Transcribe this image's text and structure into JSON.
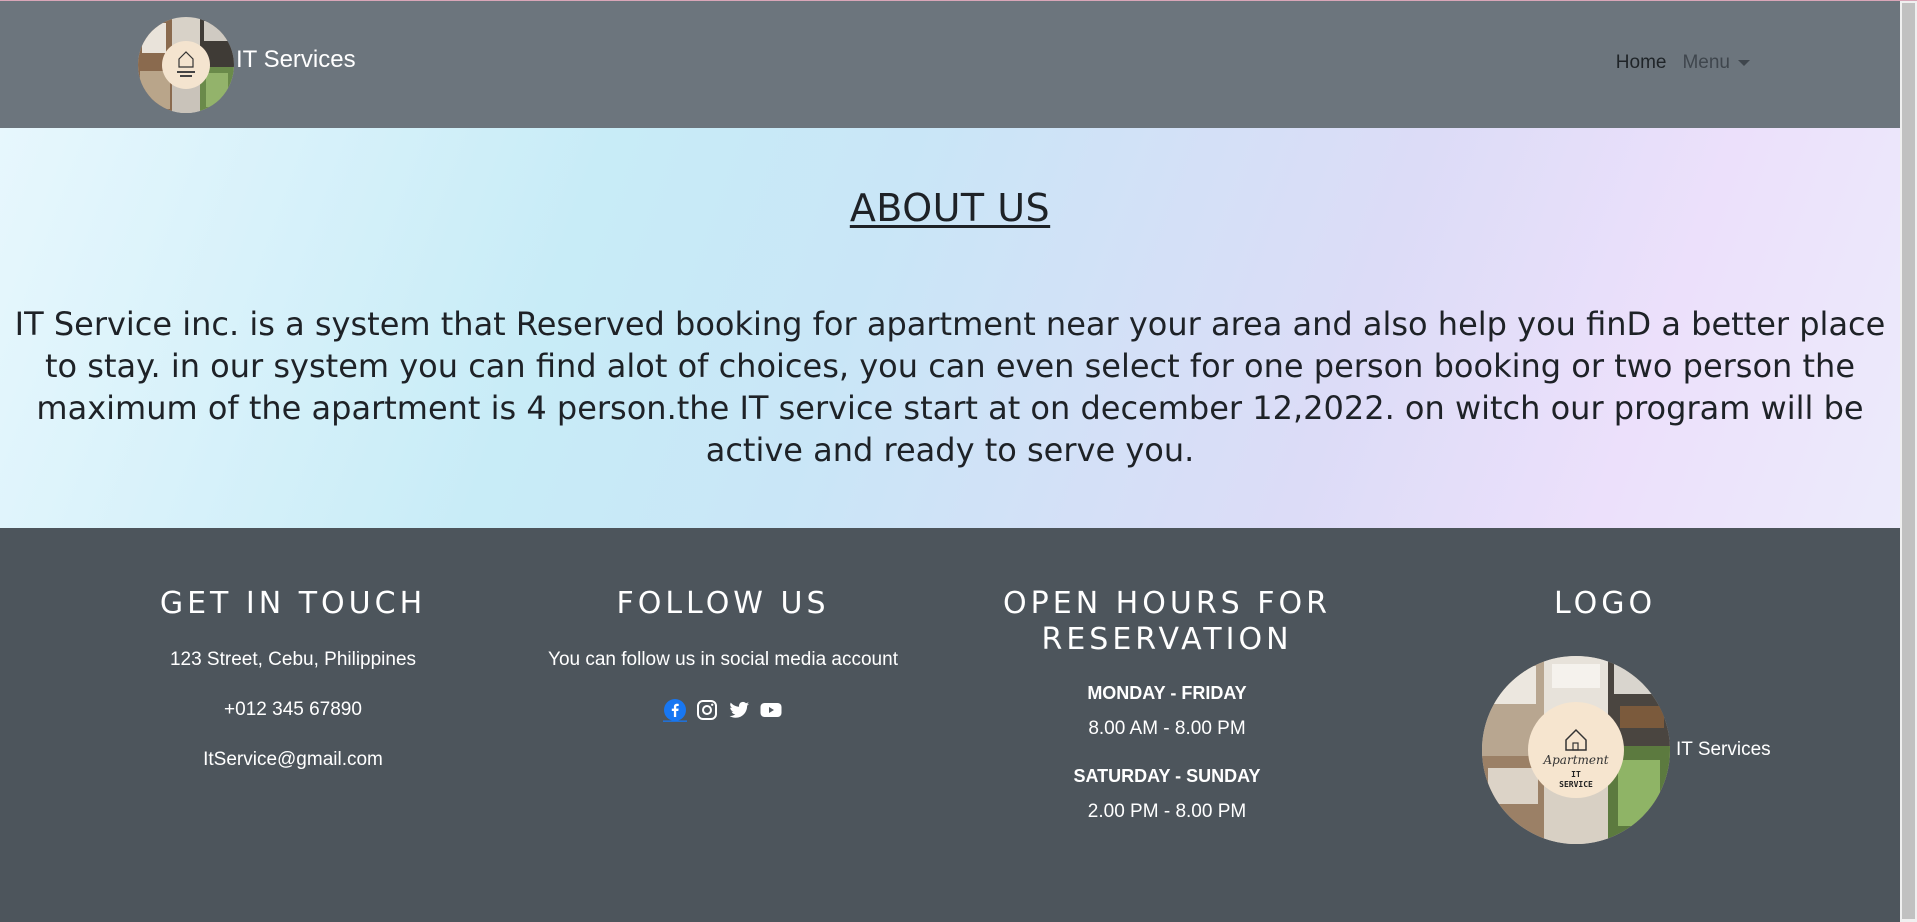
{
  "navbar": {
    "brand_text": "IT Services",
    "home_label": "Home",
    "menu_label": "Menu"
  },
  "about": {
    "title": "ABOUT US",
    "text": "IT Service inc. is a system that Reserved booking for apartment near your area and also help you finD a better place to stay. in our system you can find alot of choices, you can even select for one person booking or two person the maximum of the apartment is 4 person.the IT service start at on december 12,2022. on witch our program will be active and ready to serve you."
  },
  "footer": {
    "contact": {
      "heading": "GET IN TOUCH",
      "address": "123 Street, Cebu, Philippines",
      "phone": "+012 345 67890",
      "email": "ItService@gmail.com"
    },
    "follow": {
      "heading": "FOLLOW US",
      "text": "You can follow us in social media account",
      "icons": [
        "facebook-icon",
        "instagram-icon",
        "twitter-icon",
        "youtube-icon"
      ]
    },
    "hours": {
      "heading": "OPEN HOURS FOR RESERVATION",
      "weekday_label": "MONDAY - FRIDAY",
      "weekday_time": "8.00 AM - 8.00 PM",
      "weekend_label": "SATURDAY - SUNDAY",
      "weekend_time": "2.00 PM - 8.00 PM"
    },
    "logo": {
      "heading": "LOGO",
      "caption": "IT Services",
      "emblem_script": "Apartment",
      "emblem_line1": "IT",
      "emblem_line2": "SERVICE"
    }
  },
  "colors": {
    "navbar_bg": "#6c757d",
    "footer_bg": "#4d555c",
    "facebook": "#1877f2"
  }
}
